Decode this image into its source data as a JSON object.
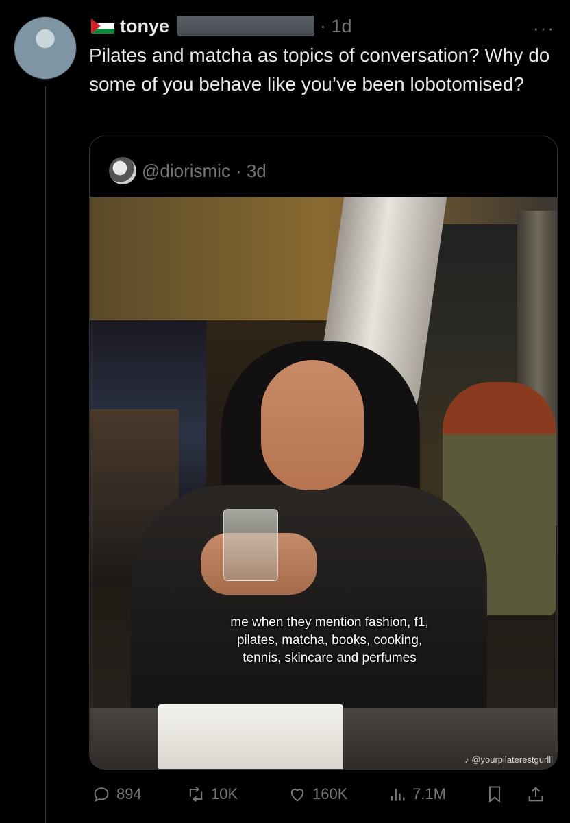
{
  "author": {
    "name": "tonye",
    "time": "· 1d",
    "more_label": "···"
  },
  "tweet": {
    "text": "Pilates and matcha as topics of conversation? Why do some of you behave like you’ve been lobotomised?"
  },
  "quote": {
    "handle": "@diorismic",
    "time": "· 3d",
    "caption": "me when they mention fashion, f1, pilates, matcha, books, cooking, tennis, skincare and perfumes",
    "watermark": "♪ @yourpilaterestgurlll"
  },
  "actions": {
    "replies": "894",
    "reposts": "10K",
    "likes": "160K",
    "views": "7.1M"
  },
  "icons": [
    "palestine-flag-icon",
    "more-icon",
    "reply-icon",
    "repost-icon",
    "like-icon",
    "views-icon",
    "bookmark-icon",
    "share-icon"
  ],
  "colors": {
    "background": "#000000",
    "text": "#e7e9ea",
    "muted": "#71767b",
    "border": "#2f3336"
  }
}
